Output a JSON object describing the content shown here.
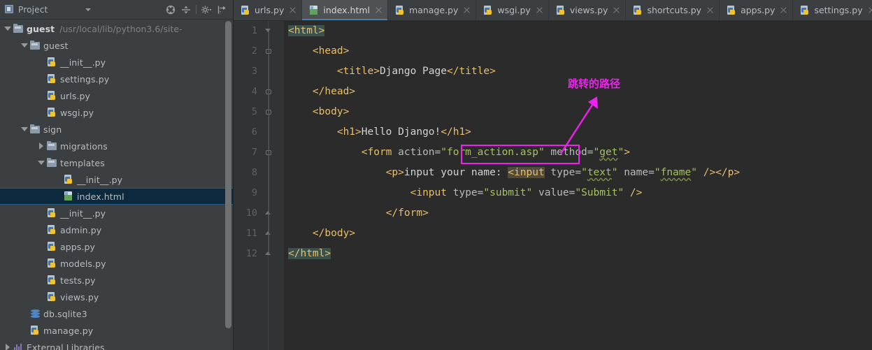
{
  "project_panel": {
    "title": "Project",
    "dropdown_icon": "chevron-down-icon",
    "tools": [
      {
        "name": "collapse-all-icon",
        "label": ""
      },
      {
        "name": "expand-all-icon",
        "label": ""
      },
      {
        "name": "settings-gear-icon",
        "label": ""
      },
      {
        "name": "hide-panel-icon",
        "label": ""
      }
    ],
    "tree": [
      {
        "id": "guest-root",
        "depth": 0,
        "arrow": "down",
        "icon": "folder-icon",
        "label": "guest",
        "bold": true,
        "path": "/usr/local/lib/python3.6/site-",
        "selected": false
      },
      {
        "id": "guest-pkg",
        "depth": 1,
        "arrow": "down",
        "icon": "folder-icon",
        "label": "guest",
        "bold": false,
        "path": "",
        "selected": false
      },
      {
        "id": "guest-init",
        "depth": 2,
        "arrow": "none",
        "icon": "python-file-icon",
        "label": "__init__.py",
        "bold": false,
        "path": "",
        "selected": false
      },
      {
        "id": "settings-py",
        "depth": 2,
        "arrow": "none",
        "icon": "python-file-icon",
        "label": "settings.py",
        "bold": false,
        "path": "",
        "selected": false
      },
      {
        "id": "urls-py",
        "depth": 2,
        "arrow": "none",
        "icon": "python-file-icon",
        "label": "urls.py",
        "bold": false,
        "path": "",
        "selected": false
      },
      {
        "id": "wsgi-py",
        "depth": 2,
        "arrow": "none",
        "icon": "python-file-icon",
        "label": "wsgi.py",
        "bold": false,
        "path": "",
        "selected": false
      },
      {
        "id": "sign-dir",
        "depth": 1,
        "arrow": "down",
        "icon": "folder-icon",
        "label": "sign",
        "bold": false,
        "path": "",
        "selected": false
      },
      {
        "id": "migrations",
        "depth": 2,
        "arrow": "right",
        "icon": "folder-icon",
        "label": "migrations",
        "bold": false,
        "path": "",
        "selected": false
      },
      {
        "id": "templates",
        "depth": 2,
        "arrow": "down",
        "icon": "folder-icon",
        "label": "templates",
        "bold": false,
        "path": "",
        "selected": false
      },
      {
        "id": "tpl-init",
        "depth": 3,
        "arrow": "none",
        "icon": "python-file-icon",
        "label": "__init__.py",
        "bold": false,
        "path": "",
        "selected": false
      },
      {
        "id": "index-html",
        "depth": 3,
        "arrow": "none",
        "icon": "html-file-icon",
        "label": "index.html",
        "bold": false,
        "path": "",
        "selected": true
      },
      {
        "id": "sign-init",
        "depth": 2,
        "arrow": "none",
        "icon": "python-file-icon",
        "label": "__init__.py",
        "bold": false,
        "path": "",
        "selected": false
      },
      {
        "id": "admin-py",
        "depth": 2,
        "arrow": "none",
        "icon": "python-file-icon",
        "label": "admin.py",
        "bold": false,
        "path": "",
        "selected": false
      },
      {
        "id": "apps-py",
        "depth": 2,
        "arrow": "none",
        "icon": "python-file-icon",
        "label": "apps.py",
        "bold": false,
        "path": "",
        "selected": false
      },
      {
        "id": "models-py",
        "depth": 2,
        "arrow": "none",
        "icon": "python-file-icon",
        "label": "models.py",
        "bold": false,
        "path": "",
        "selected": false
      },
      {
        "id": "tests-py",
        "depth": 2,
        "arrow": "none",
        "icon": "python-file-icon",
        "label": "tests.py",
        "bold": false,
        "path": "",
        "selected": false
      },
      {
        "id": "views-py",
        "depth": 2,
        "arrow": "none",
        "icon": "python-file-icon",
        "label": "views.py",
        "bold": false,
        "path": "",
        "selected": false
      },
      {
        "id": "db-sqlite3",
        "depth": 1,
        "arrow": "none",
        "icon": "database-icon",
        "label": "db.sqlite3",
        "bold": false,
        "path": "",
        "selected": false
      },
      {
        "id": "manage-py",
        "depth": 1,
        "arrow": "none",
        "icon": "python-file-icon",
        "label": "manage.py",
        "bold": false,
        "path": "",
        "selected": false
      },
      {
        "id": "external-libs",
        "depth": 0,
        "arrow": "right",
        "icon": "library-icon",
        "label": "External Libraries",
        "bold": false,
        "path": "",
        "selected": false
      }
    ]
  },
  "tabs": [
    {
      "id": "tab-urls",
      "label": "urls.py",
      "icon": "python-file-icon",
      "active": false
    },
    {
      "id": "tab-index",
      "label": "index.html",
      "icon": "html-file-icon",
      "active": true
    },
    {
      "id": "tab-manage",
      "label": "manage.py",
      "icon": "python-file-icon",
      "active": false
    },
    {
      "id": "tab-wsgi",
      "label": "wsgi.py",
      "icon": "python-file-icon",
      "active": false
    },
    {
      "id": "tab-views",
      "label": "views.py",
      "icon": "python-file-icon",
      "active": false
    },
    {
      "id": "tab-shortcuts",
      "label": "shortcuts.py",
      "icon": "python-file-icon",
      "active": false
    },
    {
      "id": "tab-apps",
      "label": "apps.py",
      "icon": "python-file-icon",
      "active": false
    },
    {
      "id": "tab-settings",
      "label": "settings.py",
      "icon": "python-file-icon",
      "active": false
    }
  ],
  "editor": {
    "filename": "index.html",
    "line_numbers": [
      "1",
      "2",
      "3",
      "4",
      "5",
      "6",
      "7",
      "8",
      "9",
      "10",
      "11",
      "12"
    ],
    "lines": [
      {
        "n": "1",
        "indent": 0,
        "spans": [
          {
            "t": "<html>",
            "c": "tag hl-tag"
          }
        ]
      },
      {
        "n": "2",
        "indent": 1,
        "spans": [
          {
            "t": "<head>",
            "c": "tag"
          }
        ]
      },
      {
        "n": "3",
        "indent": 2,
        "spans": [
          {
            "t": "<title>",
            "c": "tag"
          },
          {
            "t": "Django Page",
            "c": "txt"
          },
          {
            "t": "</title>",
            "c": "tag"
          }
        ]
      },
      {
        "n": "4",
        "indent": 1,
        "spans": [
          {
            "t": "</head>",
            "c": "tag"
          }
        ]
      },
      {
        "n": "5",
        "indent": 1,
        "spans": [
          {
            "t": "<body>",
            "c": "tag"
          }
        ]
      },
      {
        "n": "6",
        "indent": 2,
        "spans": [
          {
            "t": "<h1>",
            "c": "tag"
          },
          {
            "t": "Hello Django!",
            "c": "txt"
          },
          {
            "t": "</h1>",
            "c": "tag"
          }
        ]
      },
      {
        "n": "7",
        "indent": 3,
        "spans": [
          {
            "t": "<form",
            "c": "tag"
          },
          {
            "t": " action=",
            "c": "attr"
          },
          {
            "t": "\"form_action.asp\"",
            "c": "val"
          },
          {
            "t": " method=",
            "c": "attr"
          },
          {
            "t": "\"",
            "c": "val"
          },
          {
            "t": "get",
            "c": "val-u"
          },
          {
            "t": "\"",
            "c": "val"
          },
          {
            "t": ">",
            "c": "tag"
          }
        ]
      },
      {
        "n": "8",
        "indent": 4,
        "spans": [
          {
            "t": "<p>",
            "c": "tag"
          },
          {
            "t": "input your name: ",
            "c": "txt"
          },
          {
            "t": "<input",
            "c": "tag hl-in"
          },
          {
            "t": " type=",
            "c": "attr"
          },
          {
            "t": "\"",
            "c": "val"
          },
          {
            "t": "text",
            "c": "val-u"
          },
          {
            "t": "\"",
            "c": "val"
          },
          {
            "t": " name=",
            "c": "attr"
          },
          {
            "t": "\"",
            "c": "val"
          },
          {
            "t": "fname",
            "c": "val-u"
          },
          {
            "t": "\"",
            "c": "val"
          },
          {
            "t": " ",
            "c": "attr"
          },
          {
            "t": "/>",
            "c": "tag"
          },
          {
            "t": "</p>",
            "c": "tag"
          }
        ]
      },
      {
        "n": "9",
        "indent": 5,
        "spans": [
          {
            "t": "<input",
            "c": "tag"
          },
          {
            "t": " type=",
            "c": "attr"
          },
          {
            "t": "\"submit\"",
            "c": "val"
          },
          {
            "t": " value=",
            "c": "attr"
          },
          {
            "t": "\"Submit\"",
            "c": "val"
          },
          {
            "t": " ",
            "c": "attr"
          },
          {
            "t": "/>",
            "c": "tag"
          }
        ]
      },
      {
        "n": "10",
        "indent": 4,
        "spans": [
          {
            "t": "</form>",
            "c": "tag"
          }
        ]
      },
      {
        "n": "11",
        "indent": 1,
        "spans": [
          {
            "t": "</body>",
            "c": "tag"
          }
        ]
      },
      {
        "n": "12",
        "indent": 0,
        "spans": [
          {
            "t": "</html>",
            "c": "tag hl-tag"
          }
        ]
      }
    ],
    "fold_markers": [
      {
        "line": 1,
        "kind": "start"
      },
      {
        "line": 2,
        "kind": "mid"
      },
      {
        "line": 4,
        "kind": "mid"
      },
      {
        "line": 5,
        "kind": "mid"
      },
      {
        "line": 7,
        "kind": "mid"
      },
      {
        "line": 10,
        "kind": "end"
      },
      {
        "line": 11,
        "kind": "end"
      },
      {
        "line": 12,
        "kind": "end"
      }
    ]
  },
  "annotation": {
    "text": "跳转的路径",
    "color": "#ee22ee",
    "highlight_target": "\"form_action.asp\"",
    "arrow": "diagonal-arrow-up-right"
  },
  "colors": {
    "panel_bg": "#3c3f41",
    "editor_bg": "#2b2b2b",
    "gutter_bg": "#313335",
    "tag": "#e8bf6a",
    "string": "#a5c261",
    "text": "#d3d3d3",
    "selection": "#0d293e",
    "tab_active": "#4e5254",
    "tab_underline": "#4b7fa8",
    "annotation": "#ee22ee"
  }
}
